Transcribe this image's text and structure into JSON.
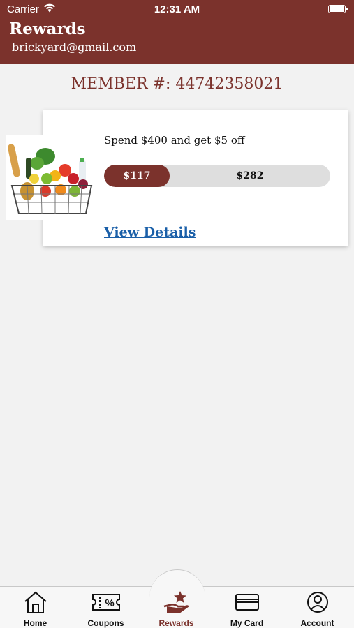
{
  "status_bar": {
    "carrier": "Carrier",
    "time": "12:31 AM"
  },
  "header": {
    "title": "Rewards",
    "email": "brickyard@gmail.com"
  },
  "member": {
    "label": "MEMBER #: 44742358021"
  },
  "reward_card": {
    "title": "Spend $400 and get $5 off",
    "progress_spent": "$117",
    "progress_remaining": "$282",
    "progress_fraction": 0.29,
    "link": "View Details",
    "image_icon": "grocery-basket-icon"
  },
  "tabs": [
    {
      "label": "Home",
      "icon": "home-icon"
    },
    {
      "label": "Coupons",
      "icon": "coupon-icon"
    },
    {
      "label": "Rewards",
      "icon": "rewards-icon",
      "active": true
    },
    {
      "label": "My Card",
      "icon": "card-icon"
    },
    {
      "label": "Account",
      "icon": "account-icon"
    }
  ],
  "colors": {
    "brand": "#7b322c",
    "link": "#1a5fa8",
    "background": "#f2f2f2"
  }
}
